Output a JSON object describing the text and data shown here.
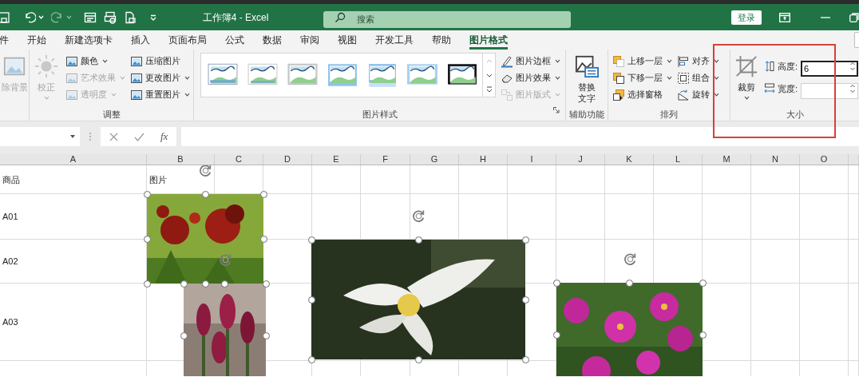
{
  "title_bar": {
    "title": "工作簿4 - Excel",
    "search": {
      "placeholder": "搜索"
    },
    "sign_in": "登录"
  },
  "tabs": [
    {
      "label": "件",
      "selected": false
    },
    {
      "label": "开始",
      "selected": false
    },
    {
      "label": "新建选项卡",
      "selected": false
    },
    {
      "label": "插入",
      "selected": false
    },
    {
      "label": "页面布局",
      "selected": false
    },
    {
      "label": "公式",
      "selected": false
    },
    {
      "label": "数据",
      "selected": false
    },
    {
      "label": "审阅",
      "selected": false
    },
    {
      "label": "视图",
      "selected": false
    },
    {
      "label": "开发工具",
      "selected": false
    },
    {
      "label": "帮助",
      "selected": false
    },
    {
      "label": "图片格式",
      "selected": true
    }
  ],
  "ribbon": {
    "groups": [
      {
        "buttons": [
          {
            "kind": "large",
            "label": "除背景",
            "disabled": true,
            "dropdown": false
          }
        ]
      },
      {
        "label": "调整",
        "buttons": [
          {
            "kind": "large",
            "label": "校正",
            "disabled": true,
            "dropdown": true
          },
          {
            "kind": "small",
            "label": "颜色",
            "disabled": false,
            "dropdown": true
          },
          {
            "kind": "small",
            "label": "艺术效果",
            "disabled": true,
            "dropdown": true
          },
          {
            "kind": "small",
            "label": "透明度",
            "disabled": true,
            "dropdown": true
          },
          {
            "kind": "small",
            "label": "压缩图片",
            "disabled": false,
            "dropdown": false
          },
          {
            "kind": "small",
            "label": "更改图片",
            "disabled": false,
            "dropdown": true
          },
          {
            "kind": "small",
            "label": "重置图片",
            "disabled": false,
            "dropdown": true
          }
        ]
      },
      {
        "label": "图片样式",
        "launcher": true,
        "gallery": [
          {
            "kind": "thin-blue"
          },
          {
            "kind": "white-frame"
          },
          {
            "kind": "gray-frame"
          },
          {
            "kind": "soft-edge"
          },
          {
            "kind": "reflected"
          },
          {
            "kind": "feathered"
          },
          {
            "kind": "black-frame"
          }
        ],
        "buttons": [
          {
            "kind": "small",
            "label": "图片边框",
            "disabled": false,
            "dropdown": true
          },
          {
            "kind": "small",
            "label": "图片效果",
            "disabled": false,
            "dropdown": true
          },
          {
            "kind": "small",
            "label": "图片版式",
            "disabled": true,
            "dropdown": true
          }
        ]
      },
      {
        "label": "辅助功能",
        "buttons": [
          {
            "kind": "large",
            "label": "替换文字",
            "disabled": false,
            "dropdown": false
          }
        ]
      },
      {
        "label": "排列",
        "buttons": [
          {
            "kind": "small",
            "label": "上移一层",
            "disabled": false,
            "dropdown": true
          },
          {
            "kind": "small",
            "label": "下移一层",
            "disabled": false,
            "dropdown": true
          },
          {
            "kind": "small",
            "label": "选择窗格",
            "disabled": false,
            "dropdown": false
          },
          {
            "kind": "small",
            "label": "对齐",
            "disabled": false,
            "dropdown": true
          },
          {
            "kind": "small",
            "label": "组合",
            "disabled": false,
            "dropdown": true
          },
          {
            "kind": "small",
            "label": "旋转",
            "disabled": false,
            "dropdown": true
          }
        ]
      },
      {
        "label": "大小",
        "buttons": [
          {
            "kind": "large",
            "label": "裁剪",
            "disabled": false,
            "dropdown": true
          },
          {
            "kind": "spin",
            "label": "高度:",
            "value": "6",
            "focused": true
          },
          {
            "kind": "spin",
            "label": "宽度:",
            "focused": false
          }
        ]
      }
    ]
  },
  "formula_bar": {
    "function_label": "fx"
  },
  "sheet": {
    "columns": [
      "A",
      "B",
      "C",
      "D",
      "E",
      "F",
      "G",
      "H",
      "I",
      "J",
      "K",
      "L",
      "M",
      "N",
      "O"
    ],
    "rows": [
      {
        "cells": [
          "商品",
          "图片"
        ]
      },
      {
        "cells": [
          "A01"
        ]
      },
      {
        "cells": [
          "A02"
        ]
      },
      {
        "cells": [
          "A03"
        ]
      }
    ],
    "pictures": [
      {
        "selected": true
      },
      {
        "selected": true
      },
      {
        "selected": true
      },
      {
        "selected": true
      }
    ]
  }
}
